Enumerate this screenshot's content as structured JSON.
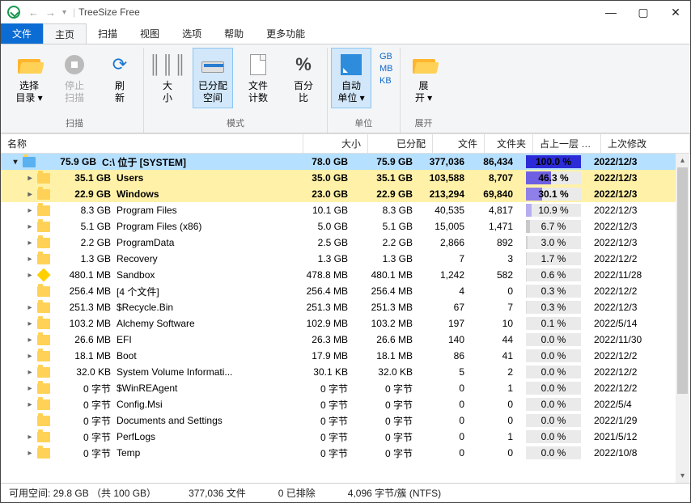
{
  "title": "TreeSize Free",
  "tabs": {
    "file": "文件",
    "home": "主页",
    "scan": "扫描",
    "view": "视图",
    "options": "选项",
    "help": "帮助",
    "more": "更多功能"
  },
  "ribbon": {
    "scan_group": "扫描",
    "select_dir": "选择\n目录 ▾",
    "stop_scan": "停止\n扫描",
    "refresh": "刷\n新",
    "mode_group": "模式",
    "size": "大\n小",
    "allocated": "已分配\n空间",
    "file_count": "文件\n计数",
    "percent": "百分\n比",
    "unit_group": "单位",
    "auto_unit": "自动\n单位 ▾",
    "gb": "GB",
    "mb": "MB",
    "kb": "KB",
    "expand_group": "展开",
    "expand": "展\n开 ▾"
  },
  "columns": {
    "name": "名称",
    "size": "大小",
    "alloc": "已分配",
    "files": "文件",
    "folders": "文件夹",
    "pct": "占上一层 %...",
    "date": "上次修改"
  },
  "rows": [
    {
      "level": 1,
      "open": true,
      "selected": true,
      "bold": true,
      "icon": "win",
      "sizelbl": "75.9 GB",
      "name": "C:\\ 位于  [SYSTEM]",
      "size": "78.0 GB",
      "alloc": "75.9 GB",
      "files": "377,036",
      "folders": "86,434",
      "pct": "100.0 %",
      "pctv": 100,
      "pcolor": "#2b2bd8",
      "date": "2022/12/3"
    },
    {
      "level": 2,
      "open": false,
      "bold": true,
      "bgyel": true,
      "icon": "folder",
      "sizelbl": "35.1 GB",
      "name": "Users",
      "size": "35.0 GB",
      "alloc": "35.1 GB",
      "files": "103,588",
      "folders": "8,707",
      "pct": "46.3 %",
      "pctv": 46.3,
      "pcolor": "#6e5fe2",
      "date": "2022/12/3"
    },
    {
      "level": 2,
      "open": false,
      "bold": true,
      "bgyel": true,
      "icon": "folder",
      "sizelbl": "22.9 GB",
      "name": "Windows",
      "size": "23.0 GB",
      "alloc": "22.9 GB",
      "files": "213,294",
      "folders": "69,840",
      "pct": "30.1 %",
      "pctv": 30.1,
      "pcolor": "#8f7fe8",
      "date": "2022/12/3"
    },
    {
      "level": 3,
      "open": false,
      "icon": "folder",
      "sizelbl": "8.3 GB",
      "name": "Program Files",
      "size": "10.1 GB",
      "alloc": "8.3 GB",
      "files": "40,535",
      "folders": "4,817",
      "pct": "10.9 %",
      "pctv": 10.9,
      "pcolor": "#b6adf0",
      "date": "2022/12/3"
    },
    {
      "level": 3,
      "open": false,
      "icon": "folder",
      "sizelbl": "5.1 GB",
      "name": "Program Files (x86)",
      "size": "5.0 GB",
      "alloc": "5.1 GB",
      "files": "15,005",
      "folders": "1,471",
      "pct": "6.7 %",
      "pctv": 6.7,
      "pcolor": "#c9c9c9",
      "date": "2022/12/3"
    },
    {
      "level": 3,
      "open": false,
      "icon": "folder",
      "sizelbl": "2.2 GB",
      "name": "ProgramData",
      "size": "2.5 GB",
      "alloc": "2.2 GB",
      "files": "2,866",
      "folders": "892",
      "pct": "3.0 %",
      "pctv": 3.0,
      "pcolor": "#d2d2d2",
      "date": "2022/12/3"
    },
    {
      "level": 3,
      "open": false,
      "icon": "folder",
      "sizelbl": "1.3 GB",
      "name": "Recovery",
      "size": "1.3 GB",
      "alloc": "1.3 GB",
      "files": "7",
      "folders": "3",
      "pct": "1.7 %",
      "pctv": 1.7,
      "pcolor": "#d6d6d6",
      "date": "2022/12/2"
    },
    {
      "level": 3,
      "open": false,
      "icon": "diamond",
      "sizelbl": "480.1 MB",
      "name": "Sandbox",
      "size": "478.8 MB",
      "alloc": "480.1 MB",
      "files": "1,242",
      "folders": "582",
      "pct": "0.6 %",
      "pctv": 0.6,
      "pcolor": "#dadada",
      "date": "2022/11/28"
    },
    {
      "level": 3,
      "noexp": true,
      "icon": "folder",
      "sizelbl": "256.4 MB",
      "name": "[4 个文件]",
      "size": "256.4 MB",
      "alloc": "256.4 MB",
      "files": "4",
      "folders": "0",
      "pct": "0.3 %",
      "pctv": 0.3,
      "pcolor": "#dcdcdc",
      "date": "2022/12/2"
    },
    {
      "level": 3,
      "open": false,
      "icon": "folder",
      "sizelbl": "251.3 MB",
      "name": "$Recycle.Bin",
      "size": "251.3 MB",
      "alloc": "251.3 MB",
      "files": "67",
      "folders": "7",
      "pct": "0.3 %",
      "pctv": 0.3,
      "pcolor": "#dcdcdc",
      "date": "2022/12/3"
    },
    {
      "level": 3,
      "open": false,
      "icon": "folder",
      "sizelbl": "103.2 MB",
      "name": "Alchemy Software",
      "size": "102.9 MB",
      "alloc": "103.2 MB",
      "files": "197",
      "folders": "10",
      "pct": "0.1 %",
      "pctv": 0.1,
      "pcolor": "#dedede",
      "date": "2022/5/14"
    },
    {
      "level": 3,
      "open": false,
      "icon": "folder",
      "sizelbl": "26.6 MB",
      "name": "EFI",
      "size": "26.3 MB",
      "alloc": "26.6 MB",
      "files": "140",
      "folders": "44",
      "pct": "0.0 %",
      "pctv": 0,
      "pcolor": "#e0e0e0",
      "date": "2022/11/30"
    },
    {
      "level": 3,
      "open": false,
      "icon": "folder",
      "sizelbl": "18.1 MB",
      "name": "Boot",
      "size": "17.9 MB",
      "alloc": "18.1 MB",
      "files": "86",
      "folders": "41",
      "pct": "0.0 %",
      "pctv": 0,
      "pcolor": "#e0e0e0",
      "date": "2022/12/2"
    },
    {
      "level": 3,
      "open": false,
      "icon": "folder",
      "sizelbl": "32.0 KB",
      "name": "System Volume Informati...",
      "size": "30.1 KB",
      "alloc": "32.0 KB",
      "files": "5",
      "folders": "2",
      "pct": "0.0 %",
      "pctv": 0,
      "pcolor": "#e0e0e0",
      "date": "2022/12/2"
    },
    {
      "level": 3,
      "open": false,
      "icon": "folder",
      "sizelbl": "0 字节",
      "name": "$WinREAgent",
      "size": "0 字节",
      "alloc": "0 字节",
      "files": "0",
      "folders": "1",
      "pct": "0.0 %",
      "pctv": 0,
      "pcolor": "#e0e0e0",
      "date": "2022/12/2"
    },
    {
      "level": 3,
      "open": false,
      "icon": "folder",
      "sizelbl": "0 字节",
      "name": "Config.Msi",
      "size": "0 字节",
      "alloc": "0 字节",
      "files": "0",
      "folders": "0",
      "pct": "0.0 %",
      "pctv": 0,
      "pcolor": "#e0e0e0",
      "date": "2022/5/4"
    },
    {
      "level": 3,
      "noexp": true,
      "icon": "folder",
      "sizelbl": "0 字节",
      "name": "Documents and Settings",
      "size": "0 字节",
      "alloc": "0 字节",
      "files": "0",
      "folders": "0",
      "pct": "0.0 %",
      "pctv": 0,
      "pcolor": "#e0e0e0",
      "date": "2022/1/29"
    },
    {
      "level": 3,
      "open": false,
      "icon": "folder",
      "sizelbl": "0 字节",
      "name": "PerfLogs",
      "size": "0 字节",
      "alloc": "0 字节",
      "files": "0",
      "folders": "1",
      "pct": "0.0 %",
      "pctv": 0,
      "pcolor": "#e0e0e0",
      "date": "2021/5/12"
    },
    {
      "level": 3,
      "open": false,
      "icon": "folder",
      "sizelbl": "0 字节",
      "name": "Temp",
      "size": "0 字节",
      "alloc": "0 字节",
      "files": "0",
      "folders": "0",
      "pct": "0.0 %",
      "pctv": 0,
      "pcolor": "#e0e0e0",
      "date": "2022/10/8"
    }
  ],
  "status": {
    "free": "可用空间: 29.8 GB （共 100 GB）",
    "files": "377,036 文件",
    "excluded": "0 已排除",
    "cluster": "4,096 字节/簇 (NTFS)"
  }
}
